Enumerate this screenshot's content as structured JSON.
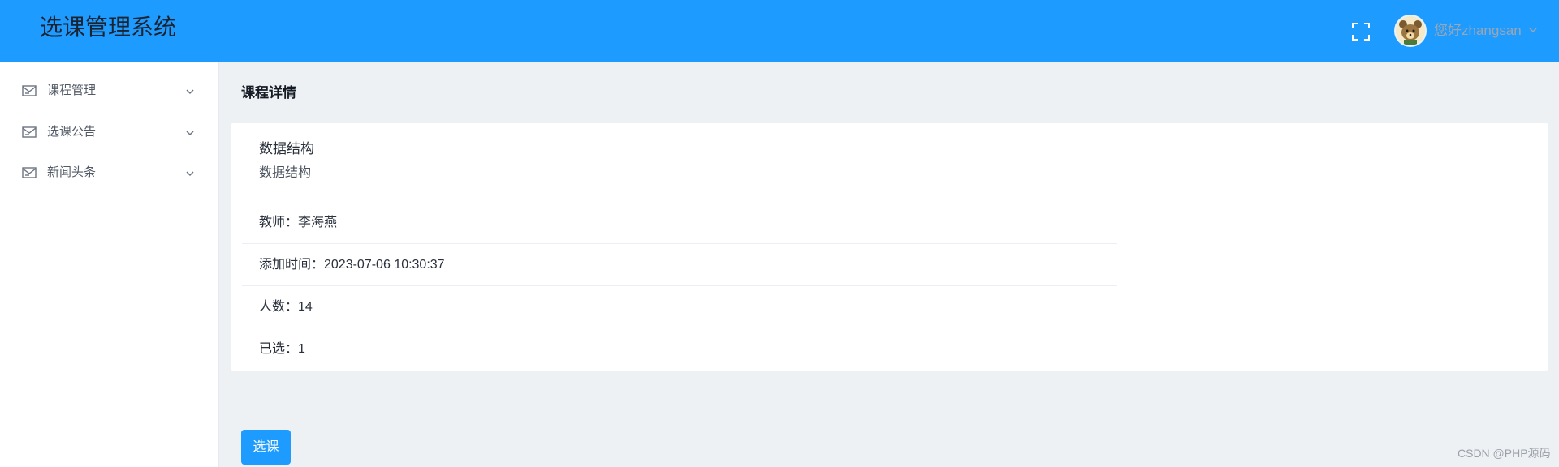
{
  "header": {
    "title": "选课管理系统",
    "fullscreen_icon": "fullscreen-icon",
    "greeting": "您好zhangsan",
    "caret_icon": "chevron-down-icon",
    "bg_color": "#1e9bff"
  },
  "sidebar": {
    "items": [
      {
        "label": "课程管理",
        "icon": "mail-icon"
      },
      {
        "label": "选课公告",
        "icon": "mail-icon"
      },
      {
        "label": "新闻头条",
        "icon": "mail-icon"
      }
    ]
  },
  "main": {
    "section_title": "课程详情",
    "course": {
      "name": "数据结构",
      "description": "数据结构",
      "teacher": "教师：李海燕",
      "added_time": "添加时间：2023-07-06 10:30:37",
      "capacity": "人数：14",
      "selected": "已选：1"
    },
    "select_button_label": "选课"
  },
  "watermark": "CSDN @PHP源码"
}
